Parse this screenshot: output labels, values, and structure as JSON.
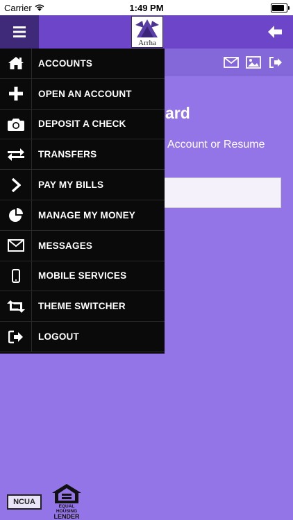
{
  "status_bar": {
    "carrier": "Carrier",
    "time": "1:49 PM"
  },
  "header": {
    "logo_text": "Arrha"
  },
  "background": {
    "title": "ard",
    "subtitle": "Account or Resume"
  },
  "menu": {
    "items": [
      {
        "label": "ACCOUNTS",
        "icon": "home-icon"
      },
      {
        "label": "OPEN AN ACCOUNT",
        "icon": "plus-icon"
      },
      {
        "label": "DEPOSIT A CHECK",
        "icon": "camera-icon"
      },
      {
        "label": "TRANSFERS",
        "icon": "transfer-arrows-icon"
      },
      {
        "label": "PAY MY BILLS",
        "icon": "chevron-right-icon"
      },
      {
        "label": "MANAGE MY MONEY",
        "icon": "pie-chart-icon"
      },
      {
        "label": "MESSAGES",
        "icon": "envelope-icon"
      },
      {
        "label": "MOBILE SERVICES",
        "icon": "mobile-phone-icon"
      },
      {
        "label": "THEME SWITCHER",
        "icon": "retweet-icon"
      },
      {
        "label": "LOGOUT",
        "icon": "sign-out-icon"
      }
    ]
  },
  "footer": {
    "ncua": "NCUA",
    "equal_housing_line1": "EQUAL HOUSING",
    "equal_housing_line2": "LENDER"
  },
  "colors": {
    "header": "#6c45c9",
    "hamburger_bg": "#3f2a7a",
    "subbar": "#8467d8",
    "page_bg": "#9475e8",
    "drawer_bg": "#0a0a0a"
  }
}
